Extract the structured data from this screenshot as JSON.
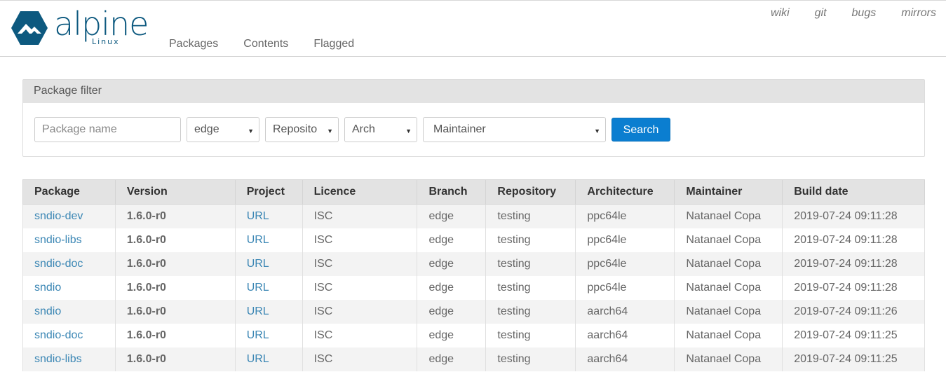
{
  "brand": {
    "name": "alpine",
    "sub": "Linux",
    "color": "#0d597f"
  },
  "nav": {
    "main": [
      "Packages",
      "Contents",
      "Flagged"
    ],
    "top": [
      "wiki",
      "git",
      "bugs",
      "mirrors"
    ]
  },
  "filter": {
    "title": "Package filter",
    "package_name_placeholder": "Package name",
    "branch": "edge",
    "repository": "Reposito",
    "arch": "Arch",
    "maintainer": "Maintainer",
    "search_label": "Search",
    "accent": "#0b7ed0"
  },
  "table": {
    "headers": [
      "Package",
      "Version",
      "Project",
      "Licence",
      "Branch",
      "Repository",
      "Architecture",
      "Maintainer",
      "Build date"
    ],
    "rows": [
      [
        "sndio-dev",
        "1.6.0-r0",
        "URL",
        "ISC",
        "edge",
        "testing",
        "ppc64le",
        "Natanael Copa",
        "2019-07-24 09:11:28"
      ],
      [
        "sndio-libs",
        "1.6.0-r0",
        "URL",
        "ISC",
        "edge",
        "testing",
        "ppc64le",
        "Natanael Copa",
        "2019-07-24 09:11:28"
      ],
      [
        "sndio-doc",
        "1.6.0-r0",
        "URL",
        "ISC",
        "edge",
        "testing",
        "ppc64le",
        "Natanael Copa",
        "2019-07-24 09:11:28"
      ],
      [
        "sndio",
        "1.6.0-r0",
        "URL",
        "ISC",
        "edge",
        "testing",
        "ppc64le",
        "Natanael Copa",
        "2019-07-24 09:11:28"
      ],
      [
        "sndio",
        "1.6.0-r0",
        "URL",
        "ISC",
        "edge",
        "testing",
        "aarch64",
        "Natanael Copa",
        "2019-07-24 09:11:26"
      ],
      [
        "sndio-doc",
        "1.6.0-r0",
        "URL",
        "ISC",
        "edge",
        "testing",
        "aarch64",
        "Natanael Copa",
        "2019-07-24 09:11:25"
      ],
      [
        "sndio-libs",
        "1.6.0-r0",
        "URL",
        "ISC",
        "edge",
        "testing",
        "aarch64",
        "Natanael Copa",
        "2019-07-24 09:11:25"
      ]
    ]
  }
}
